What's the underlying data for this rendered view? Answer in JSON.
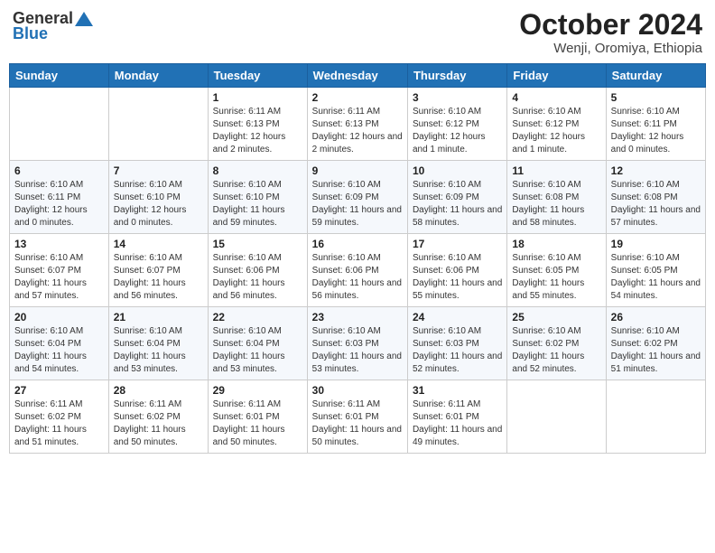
{
  "header": {
    "logo_general": "General",
    "logo_blue": "Blue",
    "month": "October 2024",
    "location": "Wenji, Oromiya, Ethiopia"
  },
  "weekdays": [
    "Sunday",
    "Monday",
    "Tuesday",
    "Wednesday",
    "Thursday",
    "Friday",
    "Saturday"
  ],
  "weeks": [
    [
      {
        "day": "",
        "info": ""
      },
      {
        "day": "",
        "info": ""
      },
      {
        "day": "1",
        "info": "Sunrise: 6:11 AM\nSunset: 6:13 PM\nDaylight: 12 hours and 2 minutes."
      },
      {
        "day": "2",
        "info": "Sunrise: 6:11 AM\nSunset: 6:13 PM\nDaylight: 12 hours and 2 minutes."
      },
      {
        "day": "3",
        "info": "Sunrise: 6:10 AM\nSunset: 6:12 PM\nDaylight: 12 hours and 1 minute."
      },
      {
        "day": "4",
        "info": "Sunrise: 6:10 AM\nSunset: 6:12 PM\nDaylight: 12 hours and 1 minute."
      },
      {
        "day": "5",
        "info": "Sunrise: 6:10 AM\nSunset: 6:11 PM\nDaylight: 12 hours and 0 minutes."
      }
    ],
    [
      {
        "day": "6",
        "info": "Sunrise: 6:10 AM\nSunset: 6:11 PM\nDaylight: 12 hours and 0 minutes."
      },
      {
        "day": "7",
        "info": "Sunrise: 6:10 AM\nSunset: 6:10 PM\nDaylight: 12 hours and 0 minutes."
      },
      {
        "day": "8",
        "info": "Sunrise: 6:10 AM\nSunset: 6:10 PM\nDaylight: 11 hours and 59 minutes."
      },
      {
        "day": "9",
        "info": "Sunrise: 6:10 AM\nSunset: 6:09 PM\nDaylight: 11 hours and 59 minutes."
      },
      {
        "day": "10",
        "info": "Sunrise: 6:10 AM\nSunset: 6:09 PM\nDaylight: 11 hours and 58 minutes."
      },
      {
        "day": "11",
        "info": "Sunrise: 6:10 AM\nSunset: 6:08 PM\nDaylight: 11 hours and 58 minutes."
      },
      {
        "day": "12",
        "info": "Sunrise: 6:10 AM\nSunset: 6:08 PM\nDaylight: 11 hours and 57 minutes."
      }
    ],
    [
      {
        "day": "13",
        "info": "Sunrise: 6:10 AM\nSunset: 6:07 PM\nDaylight: 11 hours and 57 minutes."
      },
      {
        "day": "14",
        "info": "Sunrise: 6:10 AM\nSunset: 6:07 PM\nDaylight: 11 hours and 56 minutes."
      },
      {
        "day": "15",
        "info": "Sunrise: 6:10 AM\nSunset: 6:06 PM\nDaylight: 11 hours and 56 minutes."
      },
      {
        "day": "16",
        "info": "Sunrise: 6:10 AM\nSunset: 6:06 PM\nDaylight: 11 hours and 56 minutes."
      },
      {
        "day": "17",
        "info": "Sunrise: 6:10 AM\nSunset: 6:06 PM\nDaylight: 11 hours and 55 minutes."
      },
      {
        "day": "18",
        "info": "Sunrise: 6:10 AM\nSunset: 6:05 PM\nDaylight: 11 hours and 55 minutes."
      },
      {
        "day": "19",
        "info": "Sunrise: 6:10 AM\nSunset: 6:05 PM\nDaylight: 11 hours and 54 minutes."
      }
    ],
    [
      {
        "day": "20",
        "info": "Sunrise: 6:10 AM\nSunset: 6:04 PM\nDaylight: 11 hours and 54 minutes."
      },
      {
        "day": "21",
        "info": "Sunrise: 6:10 AM\nSunset: 6:04 PM\nDaylight: 11 hours and 53 minutes."
      },
      {
        "day": "22",
        "info": "Sunrise: 6:10 AM\nSunset: 6:04 PM\nDaylight: 11 hours and 53 minutes."
      },
      {
        "day": "23",
        "info": "Sunrise: 6:10 AM\nSunset: 6:03 PM\nDaylight: 11 hours and 53 minutes."
      },
      {
        "day": "24",
        "info": "Sunrise: 6:10 AM\nSunset: 6:03 PM\nDaylight: 11 hours and 52 minutes."
      },
      {
        "day": "25",
        "info": "Sunrise: 6:10 AM\nSunset: 6:02 PM\nDaylight: 11 hours and 52 minutes."
      },
      {
        "day": "26",
        "info": "Sunrise: 6:10 AM\nSunset: 6:02 PM\nDaylight: 11 hours and 51 minutes."
      }
    ],
    [
      {
        "day": "27",
        "info": "Sunrise: 6:11 AM\nSunset: 6:02 PM\nDaylight: 11 hours and 51 minutes."
      },
      {
        "day": "28",
        "info": "Sunrise: 6:11 AM\nSunset: 6:02 PM\nDaylight: 11 hours and 50 minutes."
      },
      {
        "day": "29",
        "info": "Sunrise: 6:11 AM\nSunset: 6:01 PM\nDaylight: 11 hours and 50 minutes."
      },
      {
        "day": "30",
        "info": "Sunrise: 6:11 AM\nSunset: 6:01 PM\nDaylight: 11 hours and 50 minutes."
      },
      {
        "day": "31",
        "info": "Sunrise: 6:11 AM\nSunset: 6:01 PM\nDaylight: 11 hours and 49 minutes."
      },
      {
        "day": "",
        "info": ""
      },
      {
        "day": "",
        "info": ""
      }
    ]
  ]
}
